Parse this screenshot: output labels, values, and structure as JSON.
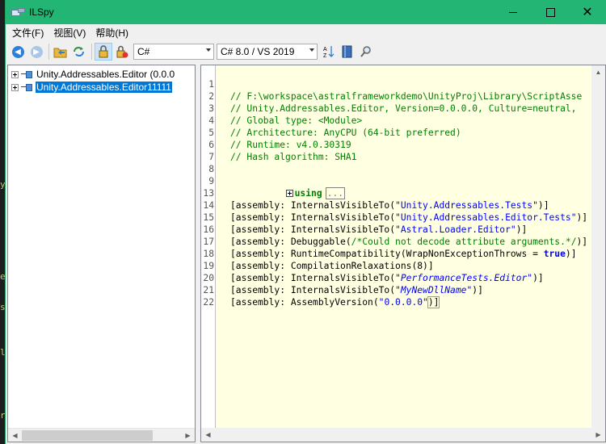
{
  "window": {
    "title": "ILSpy",
    "close_glyph": "✕"
  },
  "menu": [
    {
      "label": "文件(F)"
    },
    {
      "label": "视图(V)"
    },
    {
      "label": "帮助(H)"
    }
  ],
  "toolbar": {
    "language": "C#",
    "version": "C# 8.0 / VS 2019"
  },
  "tree": {
    "items": [
      {
        "label": "Unity.Addressables.Editor (0.0.0",
        "selected": false
      },
      {
        "label": "Unity.Addressables.Editor11111",
        "selected": true
      }
    ]
  },
  "editor": {
    "line_numbers": [
      "1",
      "2",
      "3",
      "4",
      "5",
      "6",
      "7",
      "8",
      "9",
      "13",
      "14",
      "15",
      "16",
      "17",
      "18",
      "19",
      "20",
      "21",
      "22"
    ],
    "comments": [
      "// F:\\workspace\\astralframeworkdemo\\UnityProj\\Library\\ScriptAsse",
      "// Unity.Addressables.Editor, Version=0.0.0.0, Culture=neutral,",
      "// Global type: <Module>",
      "// Architecture: AnyCPU (64-bit preferred)",
      "// Runtime: v4.0.30319",
      "// Hash algorithm: SHA1"
    ],
    "using_keyword": "using",
    "collapsed_text": "...",
    "attributes": [
      {
        "prefix": "[assembly: InternalsVisibleTo(",
        "string": "\"Unity.Addressables.Tests\"",
        "suffix": ")]"
      },
      {
        "prefix": "[assembly: InternalsVisibleTo(",
        "string": "\"Unity.Addressables.Editor.Tests\"",
        "suffix": ")]"
      },
      {
        "prefix": "[assembly: InternalsVisibleTo(",
        "string": "\"Astral.Loader.Editor\"",
        "suffix": ")]"
      },
      {
        "prefix": "[assembly: Debuggable(",
        "comment": "/*Could not decode attribute arguments.*/",
        "suffix": ")]"
      },
      {
        "prefix": "[assembly: RuntimeCompatibility(WrapNonExceptionThrows = ",
        "keyword": "true",
        "suffix": ")]"
      },
      {
        "prefix": "[assembly: CompilationRelaxations(8)]"
      },
      {
        "prefix": "[assembly: InternalsVisibleTo(",
        "string_italic": "\"PerformanceTests.Editor\"",
        "suffix": ")]"
      },
      {
        "prefix": "[assembly: InternalsVisibleTo(",
        "string_italic": "\"MyNewDllName\"",
        "suffix": ")]"
      },
      {
        "prefix": "[assembly: AssemblyVersion(",
        "string": "\"0.0.0.0\"",
        "suffix": ")]"
      }
    ]
  },
  "background": {
    "marks": [
      "y",
      "e",
      "s",
      "l",
      "r"
    ]
  }
}
